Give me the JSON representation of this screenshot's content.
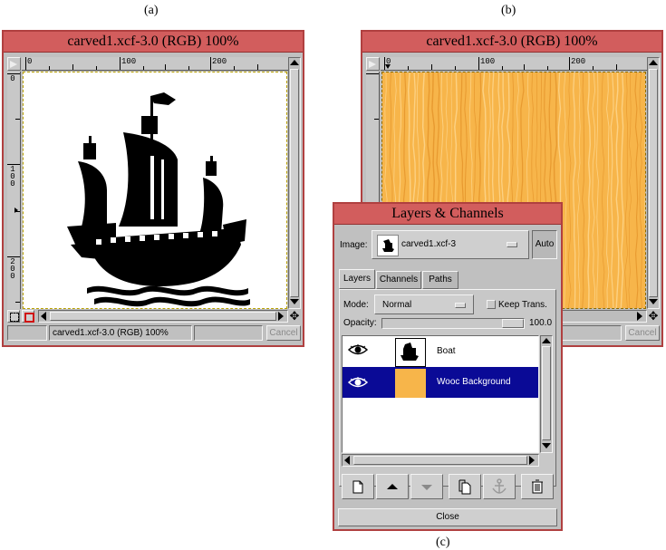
{
  "captions": {
    "a": "(a)",
    "b": "(b)",
    "c": "(c)"
  },
  "image_window_a": {
    "title": "carved1.xcf-3.0 (RGB) 100%",
    "ruler_h": [
      "0",
      "100",
      "200"
    ],
    "ruler_v": [
      "0",
      "1 0 0",
      "2 0 0"
    ],
    "status": "carved1.xcf-3.0 (RGB) 100%",
    "cancel": "Cancel"
  },
  "image_window_b": {
    "title": "carved1.xcf-3.0 (RGB) 100%",
    "ruler_h": [
      "0",
      "100",
      "200"
    ],
    "cancel": "Cancel",
    "fill_color": "#f7b54a"
  },
  "layers_dialog": {
    "title": "Layers & Channels",
    "image_label": "Image:",
    "image_value": "carved1.xcf-3",
    "auto_button": "Auto",
    "tabs": [
      "Layers",
      "Channels",
      "Paths"
    ],
    "mode_label": "Mode:",
    "mode_value": "Normal",
    "keep_trans": "Keep Trans.",
    "opacity_label": "Opacity:",
    "opacity_value": "100.0",
    "opacity_fraction": 1.0,
    "layers": [
      {
        "name": "Boat",
        "selected": false
      },
      {
        "name": "Wooc Background",
        "selected": true
      }
    ],
    "close_button": "Close",
    "selection_color": "#0a0a96"
  }
}
